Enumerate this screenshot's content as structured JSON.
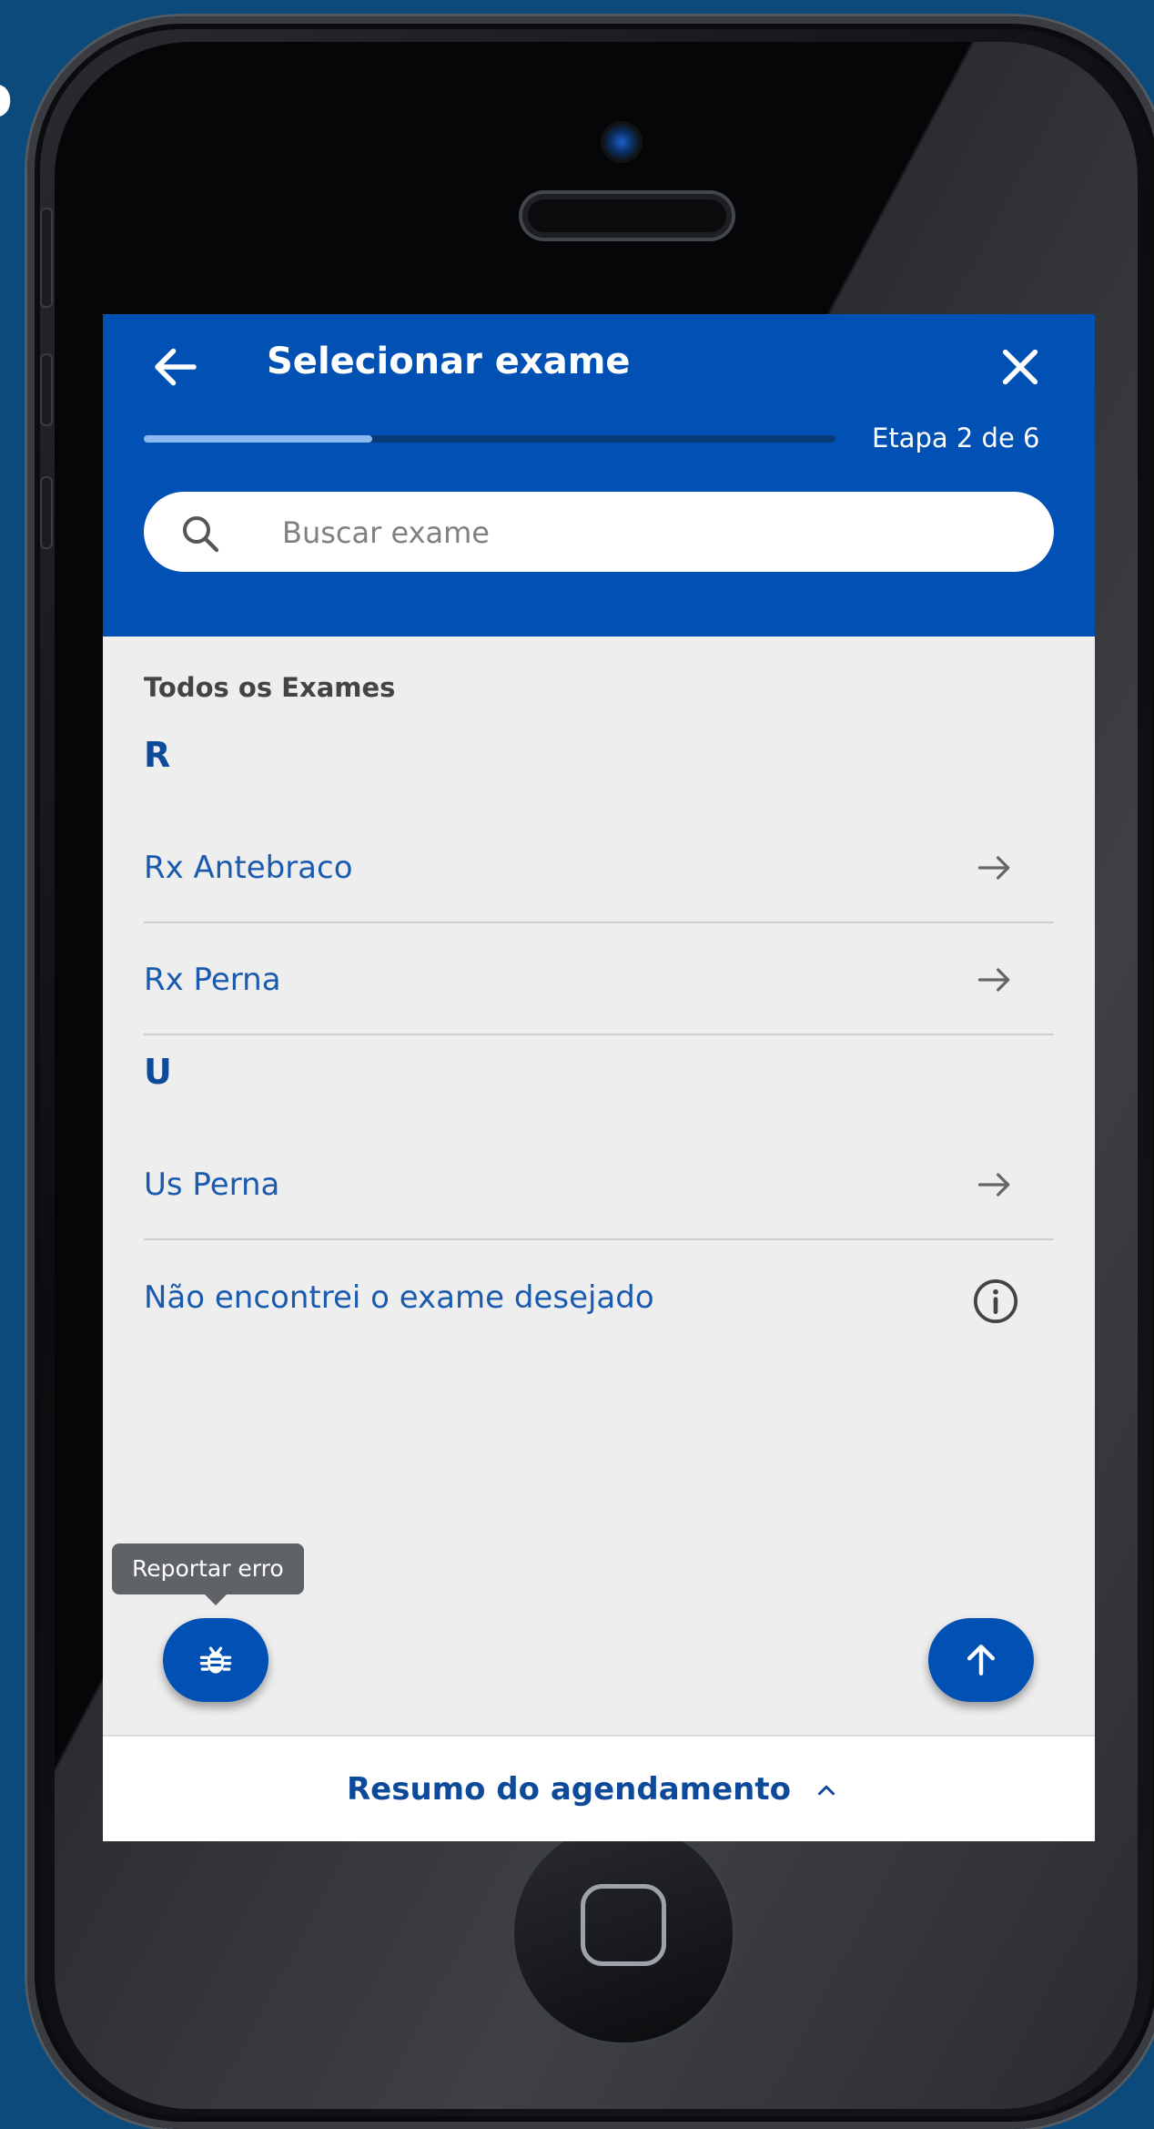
{
  "background_fragment": "o",
  "header": {
    "title": "Selecionar exame",
    "step_label": "Etapa 2 de 6",
    "progress": 0.33
  },
  "search": {
    "placeholder": "Buscar exame",
    "value": ""
  },
  "list": {
    "heading": "Todos os Exames",
    "groups": [
      {
        "letter": "R",
        "items": [
          {
            "label": "Rx Antebraco"
          },
          {
            "label": "Rx Perna"
          }
        ]
      },
      {
        "letter": "U",
        "items": [
          {
            "label": "Us Perna"
          }
        ]
      }
    ],
    "not_found_label": "Não encontrei o exame desejado"
  },
  "report": {
    "tooltip": "Reportar erro"
  },
  "bottom_bar": {
    "label": "Resumo do agendamento"
  },
  "icons": {
    "back": "arrow-left-icon",
    "close": "close-icon",
    "search": "search-icon",
    "row_arrow": "arrow-right-icon",
    "info": "info-icon",
    "bug": "bug-icon",
    "scroll_top": "arrow-up-icon",
    "expand": "chevron-up-icon"
  },
  "colors": {
    "primary": "#0051b3",
    "text_link": "#1a5bb0",
    "progress_fill": "#8bb8ef",
    "screen_bg": "#eeeeee"
  }
}
